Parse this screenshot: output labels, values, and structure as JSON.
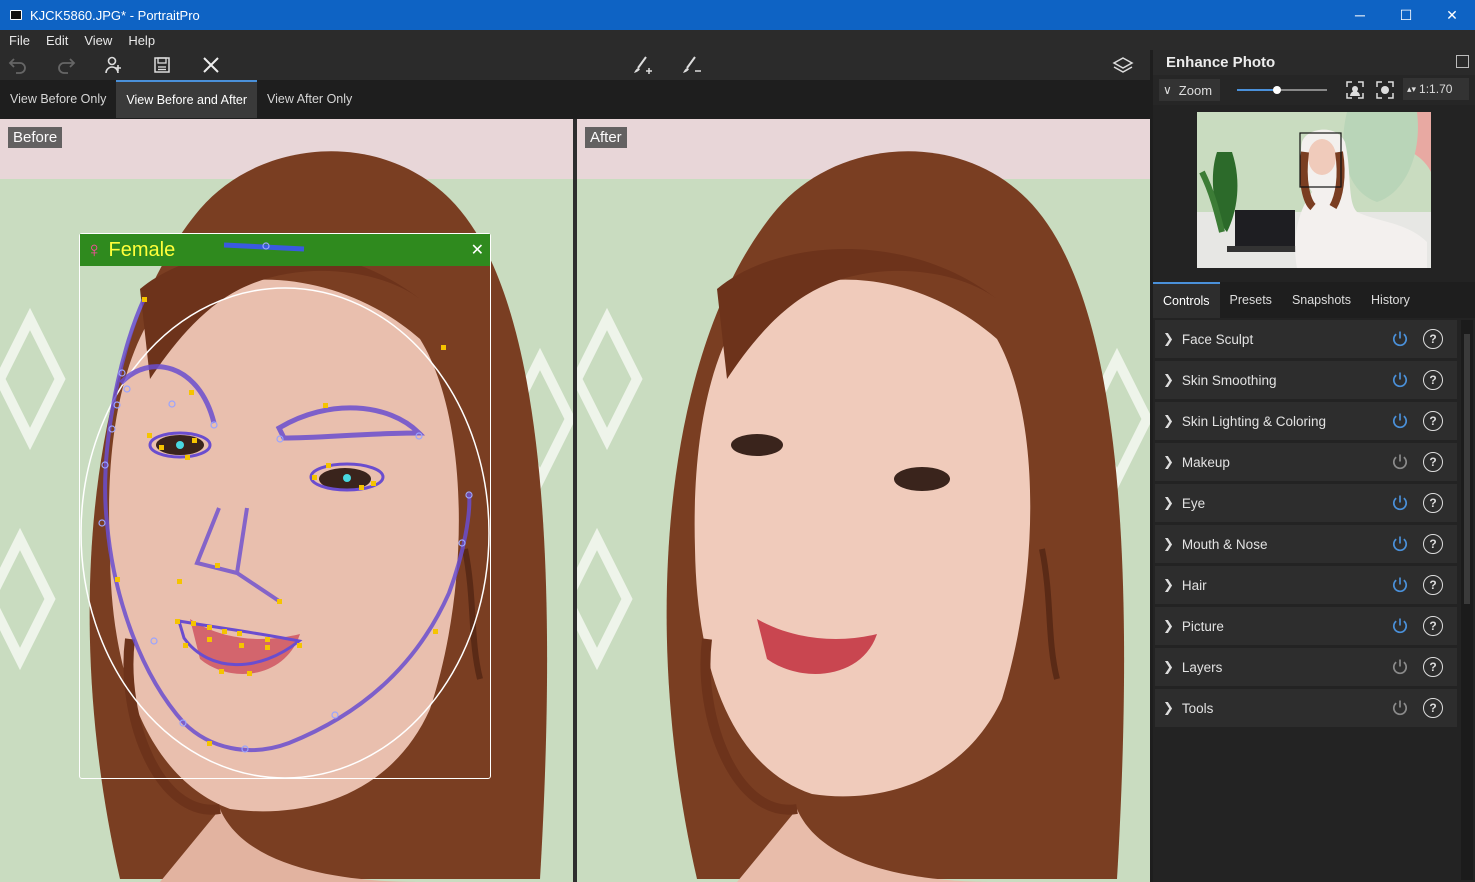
{
  "window": {
    "title": "KJCK5860.JPG* - PortraitPro",
    "minimize": "─",
    "maximize": "☐",
    "close": "✕"
  },
  "menu": [
    "File",
    "Edit",
    "View",
    "Help"
  ],
  "toolbar": {
    "icons": [
      "undo-icon",
      "redo-icon",
      "add-person-icon",
      "save-icon",
      "close-icon",
      "brush-add-icon",
      "brush-subtract-icon",
      "layers-icon"
    ]
  },
  "view_tabs": [
    {
      "label": "View Before Only",
      "active": false
    },
    {
      "label": "View Before and After",
      "active": true
    },
    {
      "label": "View After Only",
      "active": false
    }
  ],
  "before_label": "Before",
  "after_label": "After",
  "face_detect": {
    "gender_symbol": "♀",
    "label": "Female",
    "close": "✕"
  },
  "panel": {
    "title": "Enhance Photo",
    "zoom_label": "Zoom",
    "zoom_value": "1:1.70",
    "zoom_slider_level": 0.44,
    "tabs": [
      {
        "label": "Controls",
        "active": true
      },
      {
        "label": "Presets",
        "active": false
      },
      {
        "label": "Snapshots",
        "active": false
      },
      {
        "label": "History",
        "active": false
      }
    ],
    "controls": [
      {
        "label": "Face Sculpt",
        "on": true
      },
      {
        "label": "Skin Smoothing",
        "on": true
      },
      {
        "label": "Skin Lighting & Coloring",
        "on": true
      },
      {
        "label": "Makeup",
        "on": false
      },
      {
        "label": "Eye",
        "on": true
      },
      {
        "label": "Mouth & Nose",
        "on": true
      },
      {
        "label": "Hair",
        "on": true
      },
      {
        "label": "Picture",
        "on": true
      },
      {
        "label": "Layers",
        "on": false
      },
      {
        "label": "Tools",
        "on": false
      }
    ],
    "help_glyph": "?"
  },
  "colors": {
    "accent": "#4a90d9",
    "titlebar": "#0e63c4",
    "power_on": "#4a90d9",
    "power_off": "#8a8a8a",
    "face_header": "#2f8a1e"
  }
}
